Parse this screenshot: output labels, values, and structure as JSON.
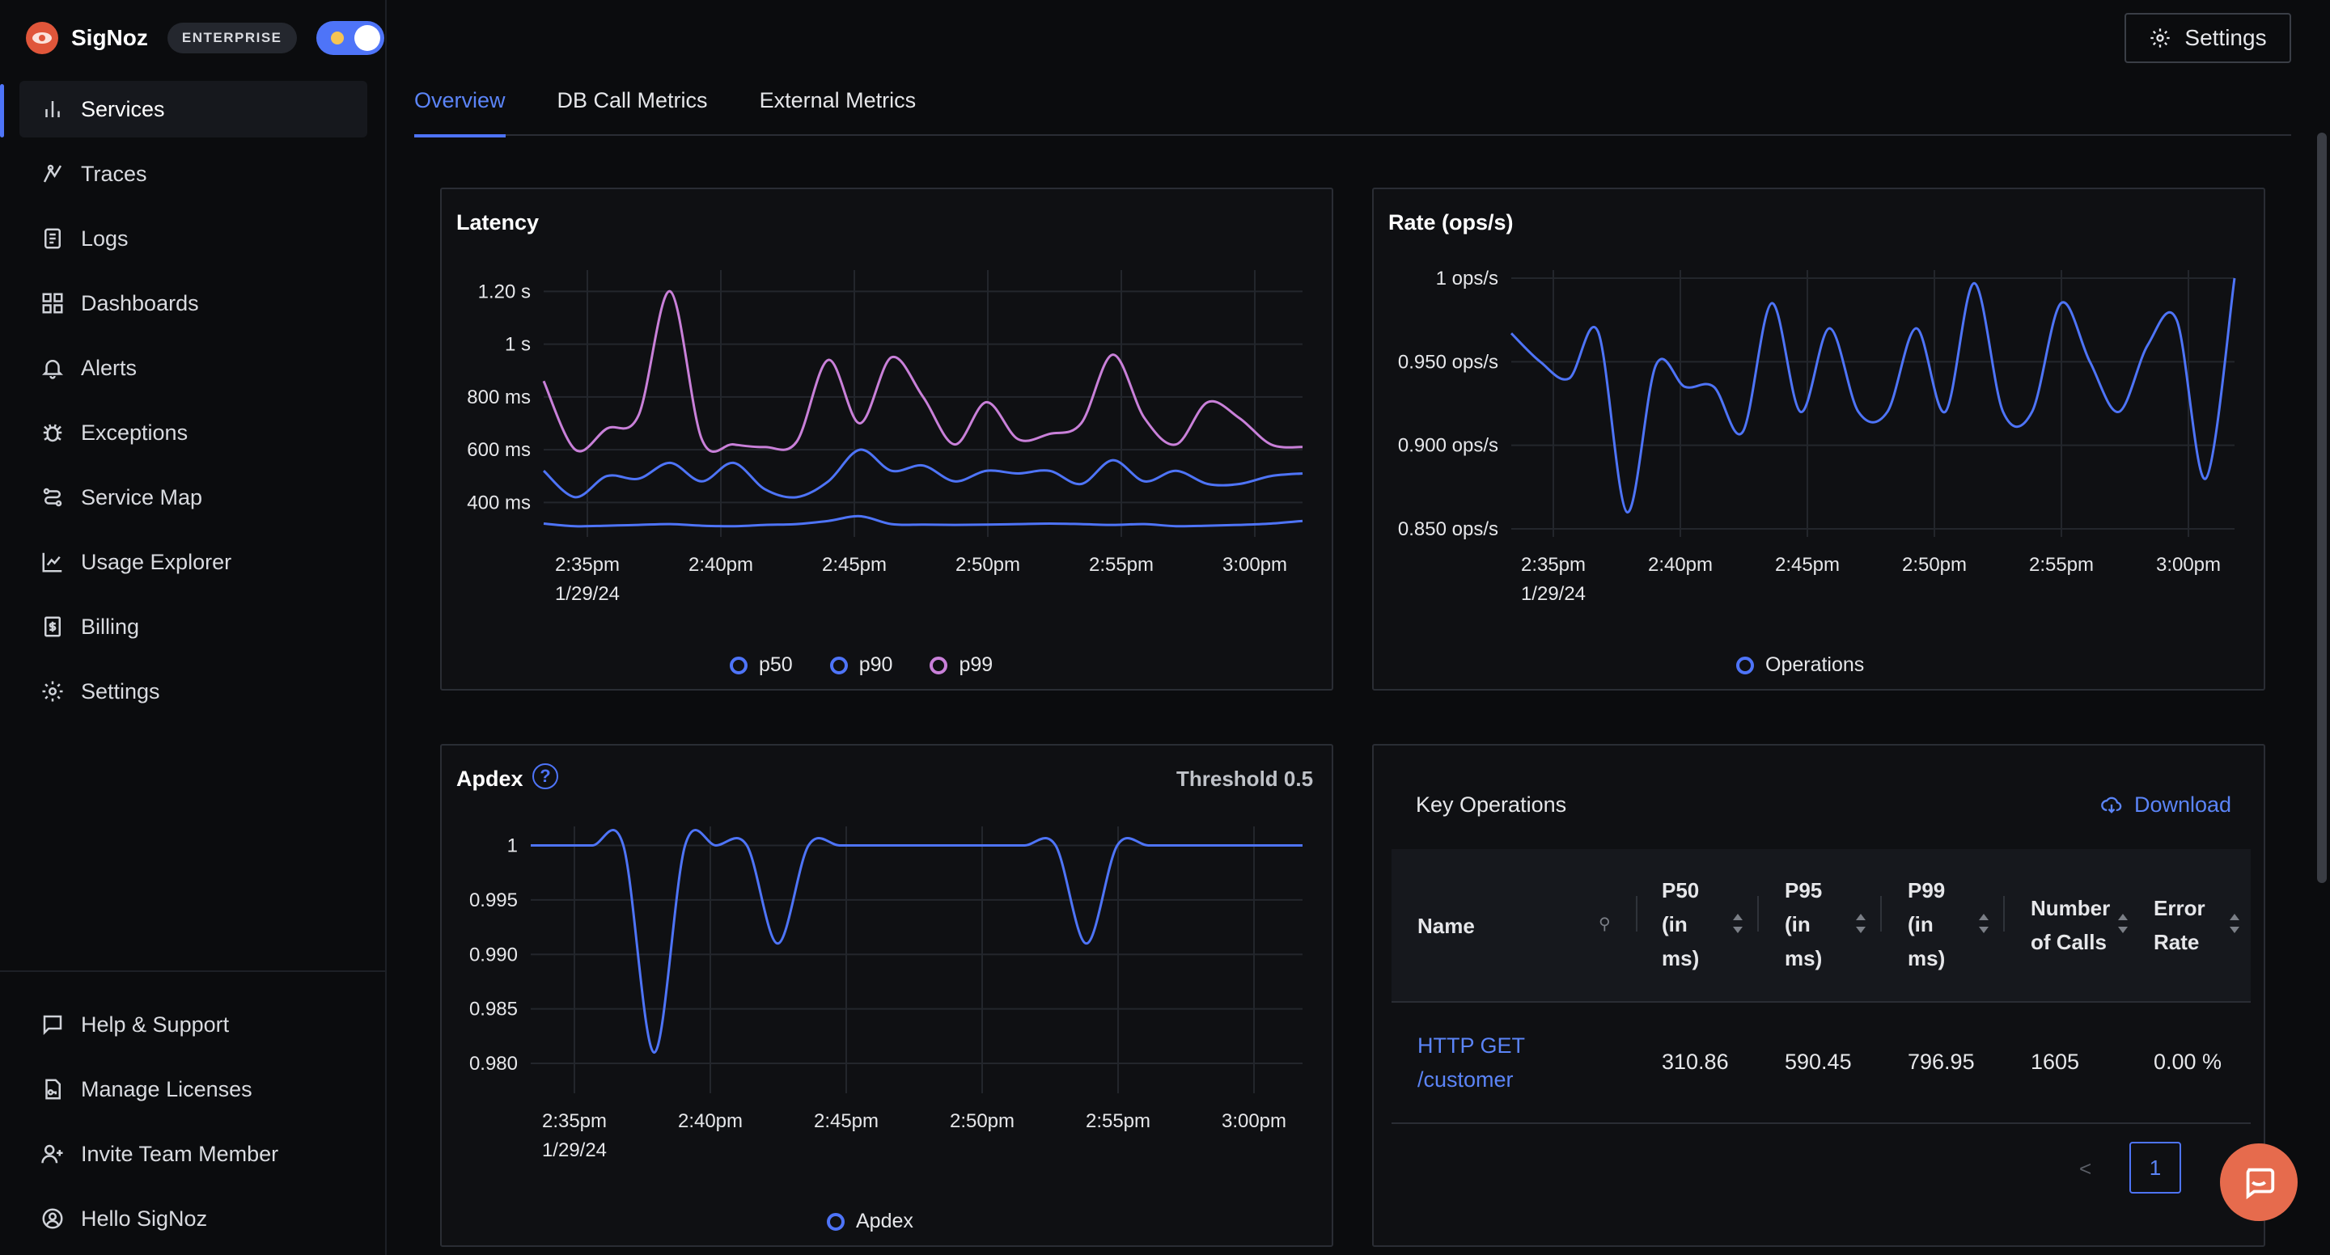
{
  "brand": {
    "name": "SigNoz",
    "edition": "ENTERPRISE"
  },
  "sidebar": {
    "items": [
      {
        "label": "Services",
        "icon": "bar-chart-icon"
      },
      {
        "label": "Traces",
        "icon": "traces-icon"
      },
      {
        "label": "Logs",
        "icon": "logs-icon"
      },
      {
        "label": "Dashboards",
        "icon": "dashboard-icon"
      },
      {
        "label": "Alerts",
        "icon": "bell-icon"
      },
      {
        "label": "Exceptions",
        "icon": "bug-icon"
      },
      {
        "label": "Service Map",
        "icon": "route-icon"
      },
      {
        "label": "Usage Explorer",
        "icon": "line-chart-icon"
      },
      {
        "label": "Billing",
        "icon": "receipt-icon"
      },
      {
        "label": "Settings",
        "icon": "gear-icon"
      }
    ],
    "bottom": [
      {
        "label": "Help & Support",
        "icon": "message-icon"
      },
      {
        "label": "Manage Licenses",
        "icon": "key-icon"
      },
      {
        "label": "Invite Team Member",
        "icon": "user-plus-icon"
      },
      {
        "label": "Hello SigNoz",
        "icon": "user-circle-icon"
      }
    ]
  },
  "header": {
    "settings_label": "Settings"
  },
  "tabs": [
    {
      "label": "Overview",
      "active": true
    },
    {
      "label": "DB Call Metrics",
      "active": false
    },
    {
      "label": "External Metrics",
      "active": false
    }
  ],
  "colors": {
    "accent": "#4e74f8",
    "p50": "#4e74f8",
    "p90": "#4e74f8",
    "p99": "#c980d9"
  },
  "chart_data": [
    {
      "type": "line",
      "title": "Latency",
      "x_ticks": [
        "2:35pm",
        "2:40pm",
        "2:45pm",
        "2:50pm",
        "2:55pm",
        "3:00pm"
      ],
      "x_date": "1/29/24",
      "y_ticks": [
        "1.20 s",
        "1 s",
        "800 ms",
        "600 ms",
        "400 ms"
      ],
      "ylim": [
        300,
        1250
      ],
      "series": [
        {
          "name": "p50",
          "color": "#4e74f8",
          "values": [
            320,
            310,
            312,
            315,
            318,
            312,
            310,
            315,
            318,
            330,
            348,
            318,
            316,
            315,
            316,
            318,
            320,
            318,
            315,
            318,
            310,
            312,
            315,
            320,
            330
          ]
        },
        {
          "name": "p90",
          "color": "#4e74f8",
          "values": [
            520,
            420,
            500,
            490,
            550,
            480,
            550,
            450,
            420,
            480,
            600,
            520,
            540,
            480,
            520,
            510,
            520,
            470,
            560,
            480,
            520,
            470,
            470,
            500,
            510
          ]
        },
        {
          "name": "p99",
          "color": "#c980d9",
          "values": [
            860,
            600,
            680,
            730,
            1200,
            640,
            620,
            610,
            630,
            940,
            700,
            950,
            800,
            620,
            780,
            640,
            660,
            700,
            960,
            720,
            620,
            780,
            720,
            620,
            610
          ]
        }
      ]
    },
    {
      "type": "line",
      "title": "Rate (ops/s)",
      "x_ticks": [
        "2:35pm",
        "2:40pm",
        "2:45pm",
        "2:50pm",
        "2:55pm",
        "3:00pm"
      ],
      "x_date": "1/29/24",
      "y_ticks": [
        "1 ops/s",
        "0.950 ops/s",
        "0.900 ops/s",
        "0.850 ops/s"
      ],
      "ylim": [
        0.85,
        1.0
      ],
      "series": [
        {
          "name": "Operations",
          "color": "#4e74f8",
          "values": [
            0.967,
            0.95,
            0.94,
            0.968,
            0.86,
            0.948,
            0.935,
            0.935,
            0.908,
            0.985,
            0.92,
            0.97,
            0.92,
            0.92,
            0.97,
            0.92,
            0.997,
            0.92,
            0.92,
            0.985,
            0.95,
            0.92,
            0.96,
            0.975,
            0.88,
            1.0
          ]
        }
      ]
    },
    {
      "type": "line",
      "title": "Apdex",
      "threshold_label": "Threshold 0.5",
      "x_ticks": [
        "2:35pm",
        "2:40pm",
        "2:45pm",
        "2:50pm",
        "2:55pm",
        "3:00pm"
      ],
      "x_date": "1/29/24",
      "y_ticks": [
        "1",
        "0.995",
        "0.990",
        "0.985",
        "0.980"
      ],
      "ylim": [
        0.978,
        1.001
      ],
      "series": [
        {
          "name": "Apdex",
          "color": "#4e74f8",
          "values": [
            1,
            1,
            1,
            1,
            0.981,
            1,
            1,
            1,
            0.991,
            1,
            1,
            1,
            1,
            1,
            1,
            1,
            1,
            1,
            0.991,
            1,
            1,
            1,
            1,
            1,
            1,
            1
          ]
        }
      ]
    }
  ],
  "key_operations": {
    "title": "Key Operations",
    "download_label": "Download",
    "columns": [
      "Name",
      "P50 (in ms)",
      "P95 (in ms)",
      "P99 (in ms)",
      "Number of Calls",
      "Error Rate"
    ],
    "rows": [
      {
        "name_line1": "HTTP GET",
        "name_line2": "/customer",
        "p50": "310.86",
        "p95": "590.45",
        "p99": "796.95",
        "calls": "1605",
        "error_rate": "0.00 %"
      }
    ],
    "page": "1",
    "prev_label": "<"
  }
}
